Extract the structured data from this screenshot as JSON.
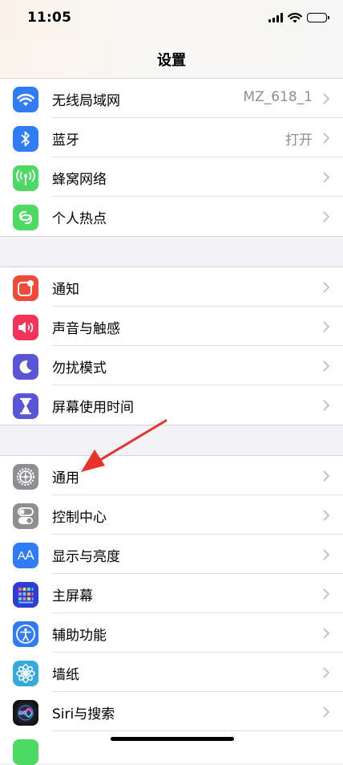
{
  "status_bar": {
    "time": "11:05"
  },
  "nav": {
    "title": "设置"
  },
  "groups": [
    [
      {
        "label": "无线局域网",
        "value": "MZ_618_1",
        "icon": "wifi-icon",
        "color": "#2f7cf6"
      },
      {
        "label": "蓝牙",
        "value": "打开",
        "icon": "bluetooth-icon",
        "color": "#2f7cf6"
      },
      {
        "label": "蜂窝网络",
        "value": "",
        "icon": "cellular-icon",
        "color": "#4cd964"
      },
      {
        "label": "个人热点",
        "value": "",
        "icon": "hotspot-icon",
        "color": "#4cd964"
      }
    ],
    [
      {
        "label": "通知",
        "value": "",
        "icon": "notifications-icon",
        "color": "#f04a3a"
      },
      {
        "label": "声音与触感",
        "value": "",
        "icon": "sound-icon",
        "color": "#f2345a"
      },
      {
        "label": "勿扰模式",
        "value": "",
        "icon": "moon-icon",
        "color": "#5a55d6"
      },
      {
        "label": "屏幕使用时间",
        "value": "",
        "icon": "hourglass-icon",
        "color": "#5a55d6"
      }
    ],
    [
      {
        "label": "通用",
        "value": "",
        "icon": "gear-icon",
        "color": "#8e8e93"
      },
      {
        "label": "控制中心",
        "value": "",
        "icon": "control-center-icon",
        "color": "#8e8e93"
      },
      {
        "label": "显示与亮度",
        "value": "",
        "icon": "display-icon",
        "color": "#2f7cf6"
      },
      {
        "label": "主屏幕",
        "value": "",
        "icon": "home-screen-icon",
        "color": "#2b3fd4"
      },
      {
        "label": "辅助功能",
        "value": "",
        "icon": "accessibility-icon",
        "color": "#2f7cf6"
      },
      {
        "label": "墙纸",
        "value": "",
        "icon": "wallpaper-icon",
        "color": "#35aadc"
      },
      {
        "label": "Siri与搜索",
        "value": "",
        "icon": "siri-icon",
        "color": "#1c1c2e"
      }
    ]
  ],
  "annotation_arrow_color": "#e8332b"
}
